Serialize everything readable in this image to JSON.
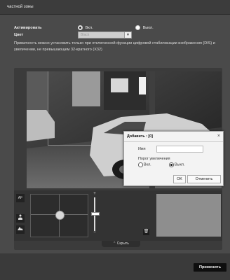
{
  "header": {
    "title": "частной зоны"
  },
  "form": {
    "activate_label": "Активировать",
    "on_label": "Вкл.",
    "off_label": "Выкл.",
    "activate_value": "on",
    "color_label": "Цвет",
    "color_value": "Black",
    "note": "Приватность можно установить только при отключенной функции цифровой стабилизации изображения (DIS) и увеличении, не превышающем 32-кратного (X32)"
  },
  "controls": {
    "af_label": "AF",
    "zoom_in": "+",
    "zoom_out": "−",
    "zoom_level": 0.45,
    "hide_label": "⌃ Скрыть"
  },
  "dialog": {
    "title": "Добавить : [0]",
    "close": "×",
    "name_label": "Имя",
    "name_value": "",
    "threshold_label": "Порог увеличения",
    "on_label": "Вкл.",
    "off_label": "Выкл.",
    "threshold_value": "off",
    "ok_label": "OK",
    "cancel_label": "Отменить"
  },
  "footer": {
    "apply_label": "Применить"
  },
  "colors": {
    "accent": "#0e0e0e",
    "panel": "#3b3b3b",
    "background": "#4a4a4a"
  },
  "icons": [
    "af-icon",
    "person-icon",
    "landscape-icon",
    "ptz-pad-icon",
    "trash-icon",
    "close-icon"
  ]
}
